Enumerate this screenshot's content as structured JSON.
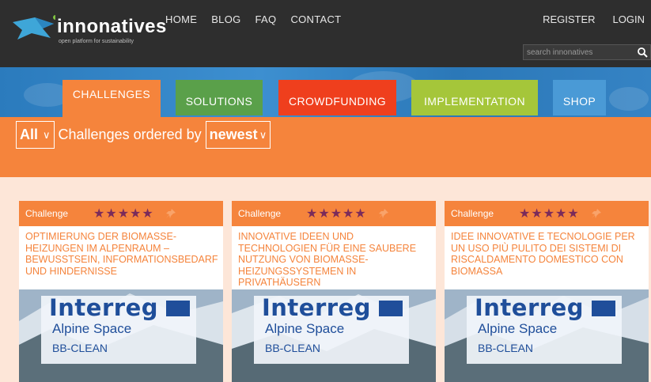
{
  "brand": {
    "name": "innonatives",
    "tagline": "open platform for sustainability"
  },
  "nav": [
    "HOME",
    "BLOG",
    "FAQ",
    "CONTACT"
  ],
  "auth": {
    "register": "REGISTER",
    "login": "LOGIN"
  },
  "search": {
    "placeholder": "search innonatives"
  },
  "tabs": [
    {
      "label": "CHALLENGES",
      "color": "#f5843c"
    },
    {
      "label": "SOLUTIONS",
      "color": "#5aa04a"
    },
    {
      "label": "CROWDFUNDING",
      "color": "#ef3f1d"
    },
    {
      "label": "IMPLEMENTATION",
      "color": "#a5c63a"
    },
    {
      "label": "SHOP",
      "color": "#4a9ad6"
    }
  ],
  "filter": {
    "category": "All",
    "text": "Challenges ordered by",
    "order": "newest"
  },
  "cards": [
    {
      "label": "Challenge",
      "rating": 5,
      "stars": "★★★★★",
      "title": "OPTIMIERUNG DER BIOMASSE-HEIZUNGEN IM ALPENRAUM – BEWUSSTSEIN, INFORMATIONSBEDARF UND HINDERNISSE"
    },
    {
      "label": "Challenge",
      "rating": 5,
      "stars": "★★★★★",
      "title": "INNOVATIVE IDEEN UND TECHNOLOGIEN FÜR EINE SAUBERE NUTZUNG VON BIOMASSE-HEIZUNGSSYSTEMEN IN PRIVATHÄUSERN"
    },
    {
      "label": "Challenge",
      "rating": 5,
      "stars": "★★★★★",
      "title": "IDEE INNOVATIVE E TECNOLOGIE PER UN USO PIÙ PULITO DEI SISTEMI DI RISCALDAMENTO DOMESTICO CON BIOMASSA"
    }
  ],
  "card_logo": {
    "word": "Interreg",
    "sub": "Alpine Space",
    "project": "BB-CLEAN"
  },
  "colors": {
    "accent": "#f5843c",
    "dark": "#2e2e2e",
    "star": "#7b2b5a",
    "interreg_blue": "#1f4e9a"
  }
}
